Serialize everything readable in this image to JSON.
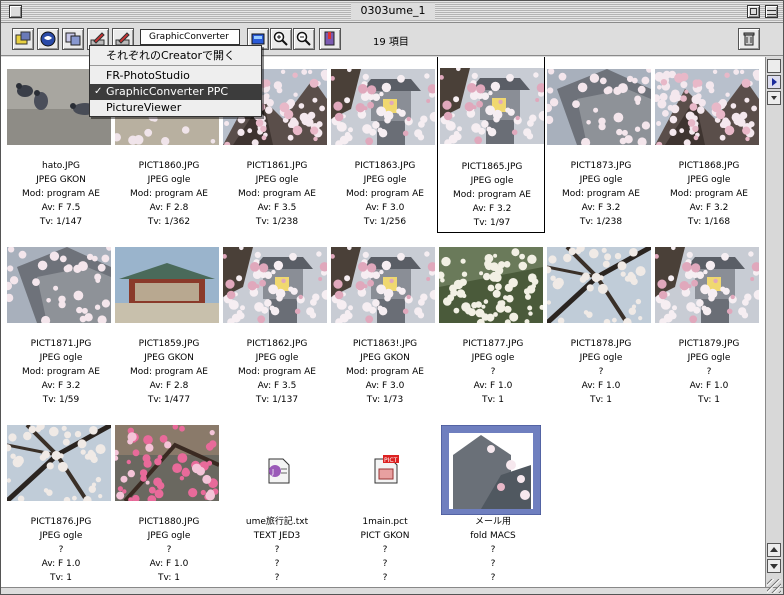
{
  "window": {
    "title": "0303ume_1"
  },
  "toolbar": {
    "creator_field": "GraphicConverter",
    "item_count": "19 項目",
    "tool_icons": [
      "new-folder-icon",
      "globe-icon",
      "window-icon",
      "pen-icon",
      "pen-icon",
      "color-icon",
      "zoom-in-icon",
      "zoom-out-icon",
      "bookmark-icon",
      "trash-icon"
    ]
  },
  "popup_menu": {
    "header": "それぞれのCreatorで開く",
    "items": [
      {
        "label": "FR-PhotoStudio",
        "checked": false
      },
      {
        "label": "GraphicConverter PPC",
        "checked": true
      },
      {
        "label": "PictureViewer",
        "checked": false
      }
    ]
  },
  "files": [
    {
      "name": "hato.JPG",
      "type": "JPEG GKON",
      "mod": "Mod: program AE",
      "av": "Av: F 7.5",
      "tv": "Tv: 1/147",
      "thumb": "pigeons"
    },
    {
      "name": "PICT1860.JPG",
      "type": "JPEG ogle",
      "mod": "Mod: program AE",
      "av": "Av: F 2.8",
      "tv": "Tv: 1/362",
      "thumb": "plaza"
    },
    {
      "name": "PICT1861.JPG",
      "type": "JPEG ogle",
      "mod": "Mod: program AE",
      "av": "Av: F 3.5",
      "tv": "Tv: 1/238",
      "thumb": "blossom"
    },
    {
      "name": "PICT1863.JPG",
      "type": "JPEG ogle",
      "mod": "Mod: program AE",
      "av": "Av: F 3.0",
      "tv": "Tv: 1/256",
      "thumb": "lantern"
    },
    {
      "name": "PICT1865.JPG",
      "type": "JPEG ogle",
      "mod": "Mod: program AE",
      "av": "Av: F 3.2",
      "tv": "Tv: 1/97",
      "thumb": "lantern"
    },
    {
      "name": "PICT1873.JPG",
      "type": "JPEG ogle",
      "mod": "Mod: program AE",
      "av": "Av: F 3.2",
      "tv": "Tv: 1/238",
      "thumb": "roof"
    },
    {
      "name": "PICT1868.JPG",
      "type": "JPEG ogle",
      "mod": "Mod: program AE",
      "av": "Av: F 3.2",
      "tv": "Tv: 1/168",
      "thumb": "blossom"
    },
    {
      "name": "PICT1871.JPG",
      "type": "JPEG ogle",
      "mod": "Mod: program AE",
      "av": "Av: F 3.2",
      "tv": "Tv: 1/59",
      "thumb": "roof"
    },
    {
      "name": "PICT1859.JPG",
      "type": "JPEG GKON",
      "mod": "Mod: program AE",
      "av": "Av: F 2.8",
      "tv": "Tv: 1/477",
      "thumb": "temple"
    },
    {
      "name": "PICT1862.JPG",
      "type": "JPEG ogle",
      "mod": "Mod: program AE",
      "av": "Av: F 3.5",
      "tv": "Tv: 1/137",
      "thumb": "lantern"
    },
    {
      "name": "PICT1863!.JPG",
      "type": "JPEG GKON",
      "mod": "Mod: program AE",
      "av": "Av: F 3.0",
      "tv": "Tv: 1/73",
      "thumb": "lantern"
    },
    {
      "name": "PICT1877.JPG",
      "type": "JPEG ogle",
      "mod": "?",
      "av": "Av: F 1.0",
      "tv": "Tv: 1",
      "thumb": "whiteflower"
    },
    {
      "name": "PICT1878.JPG",
      "type": "JPEG ogle",
      "mod": "?",
      "av": "Av: F 1.0",
      "tv": "Tv: 1",
      "thumb": "branches"
    },
    {
      "name": "PICT1879.JPG",
      "type": "JPEG ogle",
      "mod": "?",
      "av": "Av: F 1.0",
      "tv": "Tv: 1",
      "thumb": "lantern"
    },
    {
      "name": "PICT1876.JPG",
      "type": "JPEG ogle",
      "mod": "?",
      "av": "Av: F 1.0",
      "tv": "Tv: 1",
      "thumb": "branches"
    },
    {
      "name": "PICT1880.JPG",
      "type": "JPEG ogle",
      "mod": "?",
      "av": "Av: F 1.0",
      "tv": "Tv: 1",
      "thumb": "pinkplum"
    },
    {
      "name": "ume旅行記.txt",
      "type": "TEXT JED3",
      "mod": "?",
      "av": "?",
      "tv": "?",
      "thumb": "text-file-icon"
    },
    {
      "name": "1main.pct",
      "type": "PICT GKON",
      "mod": "?",
      "av": "?",
      "tv": "?",
      "thumb": "pict-file-icon"
    },
    {
      "name": "メール用",
      "type": "fold MACS",
      "mod": "?",
      "av": "?",
      "tv": "?",
      "thumb": "folder-icon"
    }
  ],
  "colors": {
    "selection": "#3c3c3c",
    "folder": "#6f7fbf"
  }
}
